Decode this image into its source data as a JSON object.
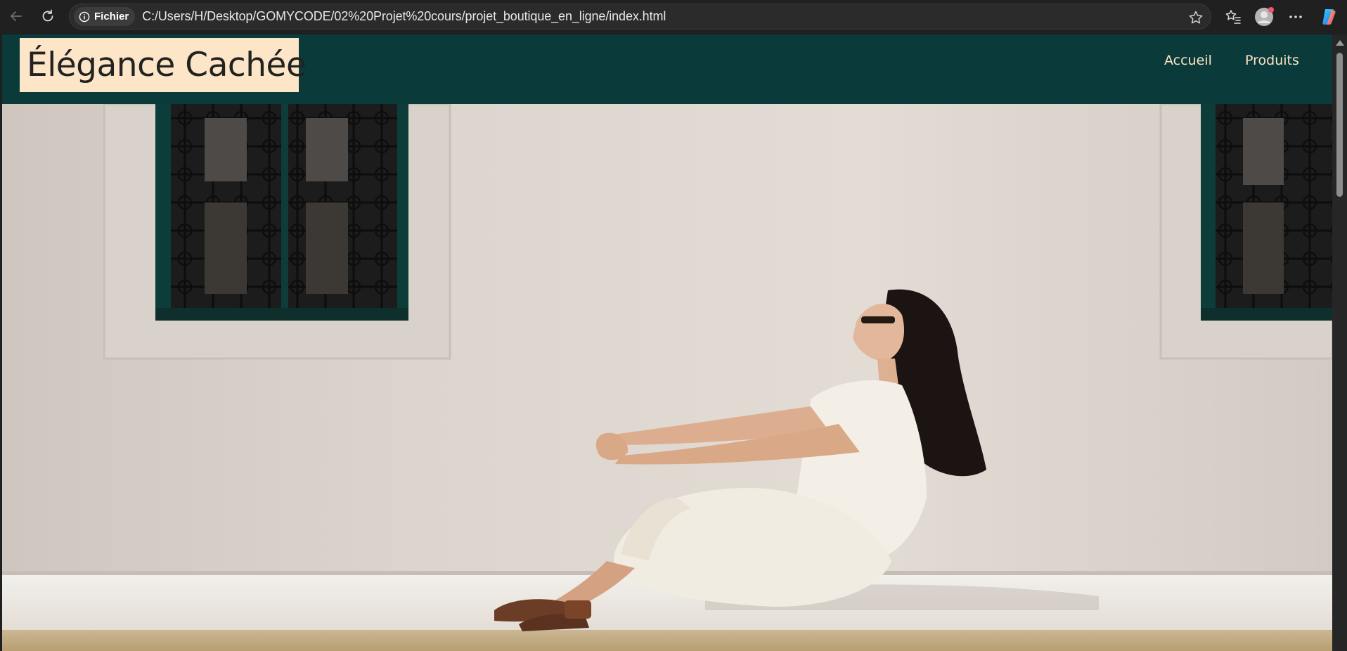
{
  "browser": {
    "site_info_label": "Fichier",
    "url": "C:/Users/H/Desktop/GOMYCODE/02%20Projet%20cours/projet_boutique_en_ligne/index.html"
  },
  "site": {
    "logo": "Élégance Cachée",
    "nav": [
      {
        "label": "Accueil"
      },
      {
        "label": "Produits"
      }
    ]
  },
  "hero": {
    "image": "woman-in-white-dress-sitting-against-white-wall"
  },
  "colors": {
    "header_bg": "#0a3a3a",
    "logo_bg": "#fde5c7",
    "nav_text": "#fde5c7"
  }
}
